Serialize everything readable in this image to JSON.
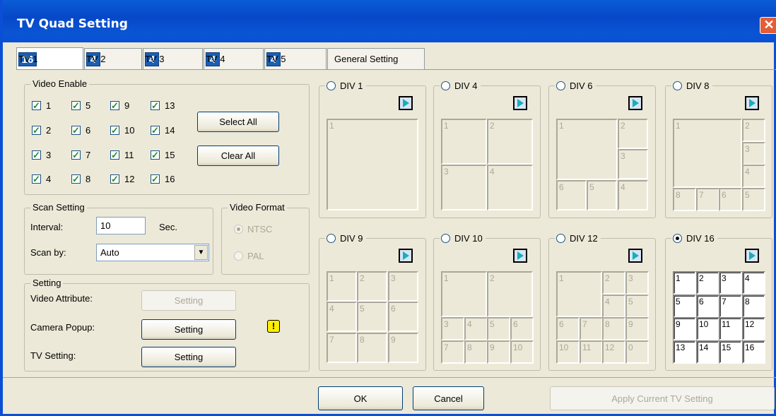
{
  "window": {
    "title": "TV Quad Setting",
    "close_glyph": "✕"
  },
  "tabs": [
    {
      "icon_text": "16",
      "label": "TV 1",
      "active": true
    },
    {
      "icon_text": "4",
      "label": "TV 2"
    },
    {
      "icon_text": "4",
      "label": "TV 3"
    },
    {
      "icon_text": "4",
      "label": "TV 4"
    },
    {
      "icon_text": "4",
      "label": "TV 5"
    },
    {
      "label": "General Setting"
    }
  ],
  "video_enable": {
    "title": "Video Enable",
    "channels": [
      "1",
      "5",
      "9",
      "13",
      "2",
      "6",
      "10",
      "14",
      "3",
      "7",
      "11",
      "15",
      "4",
      "8",
      "12",
      "16"
    ],
    "checked": true,
    "select_all": "Select All",
    "clear_all": "Clear All"
  },
  "scan": {
    "title": "Scan Setting",
    "interval_label": "Interval:",
    "interval_value": "10",
    "unit": "Sec.",
    "scan_by_label": "Scan by:",
    "scan_by_value": "Auto"
  },
  "format": {
    "title": "Video Format",
    "ntsc": "NTSC",
    "pal": "PAL",
    "selected": "NTSC"
  },
  "setting": {
    "title": "Setting",
    "video_attr_label": "Video Attribute:",
    "camera_popup_label": "Camera Popup:",
    "tv_setting_label": "TV Setting:",
    "button_label": "Setting",
    "warning_glyph": "!"
  },
  "divisions": [
    {
      "label": "DIV 1",
      "cells": [
        "1"
      ]
    },
    {
      "label": "DIV 4",
      "cells": [
        "1",
        "2",
        "3",
        "4"
      ]
    },
    {
      "label": "DIV 6",
      "cells": [
        "1",
        "2",
        "3",
        "6",
        "5",
        "4"
      ]
    },
    {
      "label": "DIV 8",
      "cells": [
        "1",
        "2",
        "3",
        "4",
        "8",
        "7",
        "6",
        "5"
      ]
    },
    {
      "label": "DIV 9",
      "cells": [
        "1",
        "2",
        "3",
        "4",
        "5",
        "6",
        "7",
        "8",
        "9"
      ]
    },
    {
      "label": "DIV 10",
      "cells": [
        "1",
        "2",
        "3",
        "4",
        "5",
        "6",
        "7",
        "8",
        "9",
        "10"
      ]
    },
    {
      "label": "DIV 12",
      "cells": [
        "1",
        "2",
        "3",
        "4",
        "5",
        "6",
        "7",
        "8",
        "9",
        "10",
        "11",
        "12",
        "0"
      ]
    },
    {
      "label": "DIV 16",
      "selected": true,
      "cells": [
        "1",
        "2",
        "3",
        "4",
        "5",
        "6",
        "7",
        "8",
        "9",
        "10",
        "11",
        "12",
        "13",
        "14",
        "15",
        "16"
      ]
    }
  ],
  "footer": {
    "ok": "OK",
    "cancel": "Cancel",
    "apply": "Apply Current TV Setting"
  }
}
